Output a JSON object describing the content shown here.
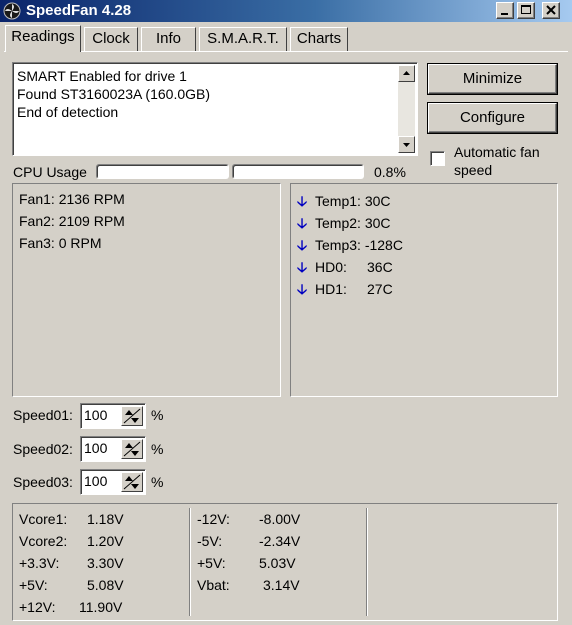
{
  "window": {
    "title": "SpeedFan 4.28"
  },
  "tabs": [
    "Readings",
    "Clock",
    "Info",
    "S.M.A.R.T.",
    "Charts"
  ],
  "log": {
    "lines": [
      "SMART Enabled for drive 1",
      "Found ST3160023A (160.0GB)",
      "End of detection"
    ]
  },
  "buttons": {
    "minimize": "Minimize",
    "configure": "Configure"
  },
  "auto_fan": {
    "label": "Automatic fan speed",
    "checked": false
  },
  "cpu": {
    "label": "CPU Usage",
    "value": "0.8%"
  },
  "fans": [
    "Fan1: 2136 RPM",
    "Fan2: 2109 RPM",
    "Fan3: 0 RPM"
  ],
  "temps": [
    {
      "name": "Temp1:",
      "value": "30C",
      "trend": "down"
    },
    {
      "name": "Temp2:",
      "value": "30C",
      "trend": "down"
    },
    {
      "name": "Temp3:",
      "value": "-128C",
      "trend": "down"
    },
    {
      "name": "HD0:",
      "value": "36C",
      "trend": "down"
    },
    {
      "name": "HD1:",
      "value": "27C",
      "trend": "down"
    }
  ],
  "speeds": [
    {
      "label": "Speed01:",
      "value": "100",
      "unit": "%"
    },
    {
      "label": "Speed02:",
      "value": "100",
      "unit": "%"
    },
    {
      "label": "Speed03:",
      "value": "100",
      "unit": "%"
    }
  ],
  "voltages_left": [
    {
      "name": "Vcore1:",
      "value": "1.18V"
    },
    {
      "name": "Vcore2:",
      "value": "1.20V"
    },
    {
      "name": "+3.3V:",
      "value": "3.30V"
    },
    {
      "name": "+5V:",
      "value": "5.08V"
    },
    {
      "name": "+12V:",
      "value": "11.90V"
    }
  ],
  "voltages_right": [
    {
      "name": "-12V:",
      "value": "-8.00V"
    },
    {
      "name": "-5V:",
      "value": "-2.34V"
    },
    {
      "name": "+5V:",
      "value": "5.03V"
    },
    {
      "name": "Vbat:",
      "value": "3.14V"
    }
  ],
  "colors": {
    "title_start": "#0a246a",
    "title_end": "#a6caf0",
    "trend_arrow": "#0000c0",
    "face": "#d4d0c8"
  }
}
